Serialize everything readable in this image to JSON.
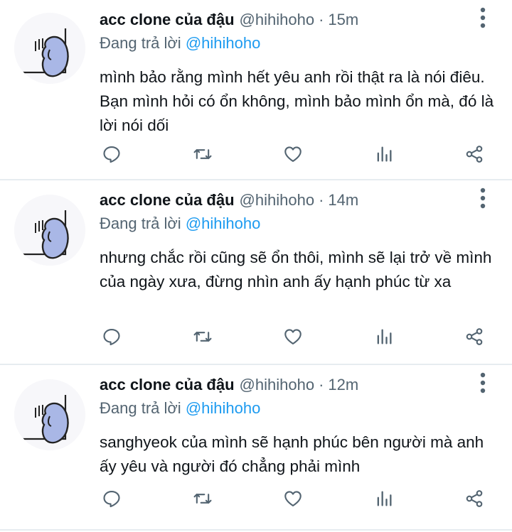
{
  "tweets": [
    {
      "name": "acc clone của đậu",
      "handle": "@hihihoho",
      "dot": "·",
      "time": "15m",
      "reply_prefix": "Đang trả lời",
      "reply_to": "@hihihoho",
      "text": "mình bảo rằng mình hết yêu anh rồi thật ra là nói điêu. Bạn mình hỏi có ổn không, mình bảo mình ổn mà, đó là lời nói dối"
    },
    {
      "name": "acc clone của đậu",
      "handle": "@hihihoho",
      "dot": "·",
      "time": "14m",
      "reply_prefix": "Đang trả lời",
      "reply_to": "@hihihoho",
      "text": "nhưng chắc rồi cũng sẽ ổn thôi, mình sẽ lại trở về mình của ngày xưa, đừng nhìn anh ấy hạnh phúc từ xa"
    },
    {
      "name": "acc clone của đậu",
      "handle": "@hihihoho",
      "dot": "·",
      "time": "12m",
      "reply_prefix": "Đang trả lời",
      "reply_to": "@hihihoho",
      "text": "sanghyeok của mình sẽ hạnh phúc bên người mà anh ấy yêu và người đó chẳng phải mình"
    }
  ],
  "icons": {
    "avatar": "avatar-doodle",
    "more": "more-vertical-icon",
    "reply": "reply-icon",
    "retweet": "retweet-icon",
    "like": "heart-icon",
    "analytics": "analytics-icon",
    "share": "share-icon"
  },
  "colors": {
    "mention": "#1d9bf0",
    "secondary_text": "#536471",
    "icon": "#536471",
    "divider": "#e6ecf0",
    "avatar_fill": "#a9b7e6"
  }
}
